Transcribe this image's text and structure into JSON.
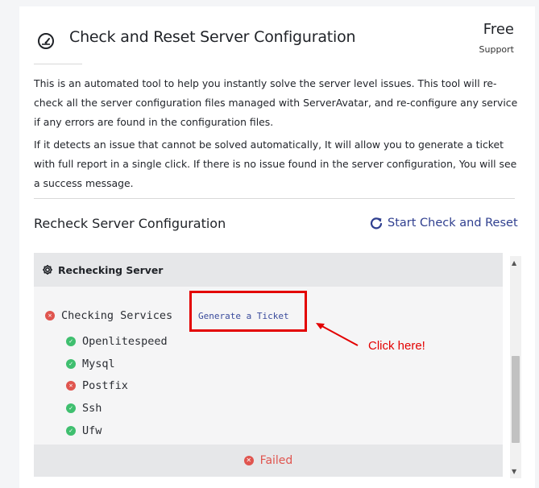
{
  "header": {
    "title": "Check and Reset Server Configuration",
    "badge_main": "Free",
    "badge_sub": "Support"
  },
  "description": {
    "paragraph1": "This is an automated tool to help you instantly solve the server level issues. This tool will re-check all the server configuration files managed with ServerAvatar, and re-configure any service if any errors are found in the configuration files.",
    "paragraph2": "If it detects an issue that cannot be solved automatically, It will allow you to generate a ticket with full report in a single click. If there is no issue found in the server configuration, You will see a success message."
  },
  "section": {
    "title": "Recheck Server Configuration",
    "action_label": "Start Check and Reset"
  },
  "panel": {
    "header_label": "Rechecking Server",
    "main_check": {
      "label": "Checking Services",
      "status": "error"
    },
    "ticket_link": "Generate a Ticket",
    "services": [
      {
        "name": "Openlitespeed",
        "status": "ok"
      },
      {
        "name": "Mysql",
        "status": "ok"
      },
      {
        "name": "Postfix",
        "status": "error"
      },
      {
        "name": "Ssh",
        "status": "ok"
      },
      {
        "name": "Ufw",
        "status": "ok"
      }
    ],
    "footer_label": "Failed"
  },
  "annotation": {
    "note": "Click here!",
    "color": "#e30000"
  },
  "colors": {
    "ok": "#3fbf6f",
    "error": "#e0554f",
    "link": "#2f3f8f"
  },
  "icons": {
    "title": "gauge-icon",
    "action": "refresh-icon",
    "panel_header": "gear-icon",
    "ok": "check-circle-icon",
    "error": "x-circle-icon"
  }
}
